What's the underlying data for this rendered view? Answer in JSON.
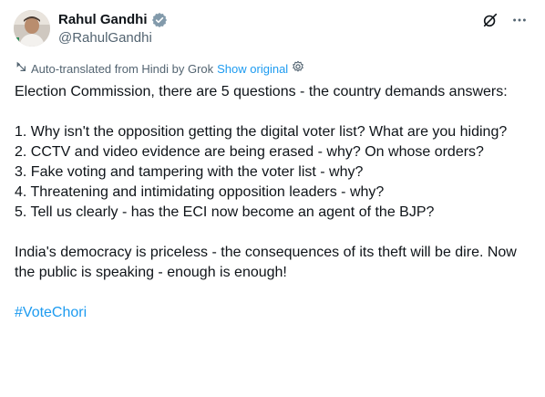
{
  "author": {
    "display_name": "Rahul Gandhi",
    "handle": "@RahulGandhi",
    "verified": true,
    "avatar": "profile-photo"
  },
  "actions": {
    "grok_icon": "grok-icon",
    "more_icon": "more-options-icon"
  },
  "translation": {
    "note": "Auto-translated from Hindi by Grok",
    "show_original": "Show original",
    "settings_icon": "gear-icon"
  },
  "post": {
    "intro": "Election Commission, there are 5 questions - the country demands answers:",
    "questions": [
      "1. Why isn't the opposition getting the digital voter list? What are you hiding?",
      "2. CCTV and video evidence are being erased - why? On whose orders?",
      "3. Fake voting and tampering with the voter list - why?",
      "4. Threatening and intimidating opposition leaders - why?",
      "5. Tell us clearly - has the ECI now become an agent of the BJP?"
    ],
    "closing": "India's democracy is priceless - the consequences of its theft will be dire. Now the public is speaking - enough is enough!",
    "hashtag": "#VoteChori"
  },
  "colors": {
    "accent": "#1d9bf0",
    "text": "#0f1419",
    "secondary": "#536471"
  }
}
